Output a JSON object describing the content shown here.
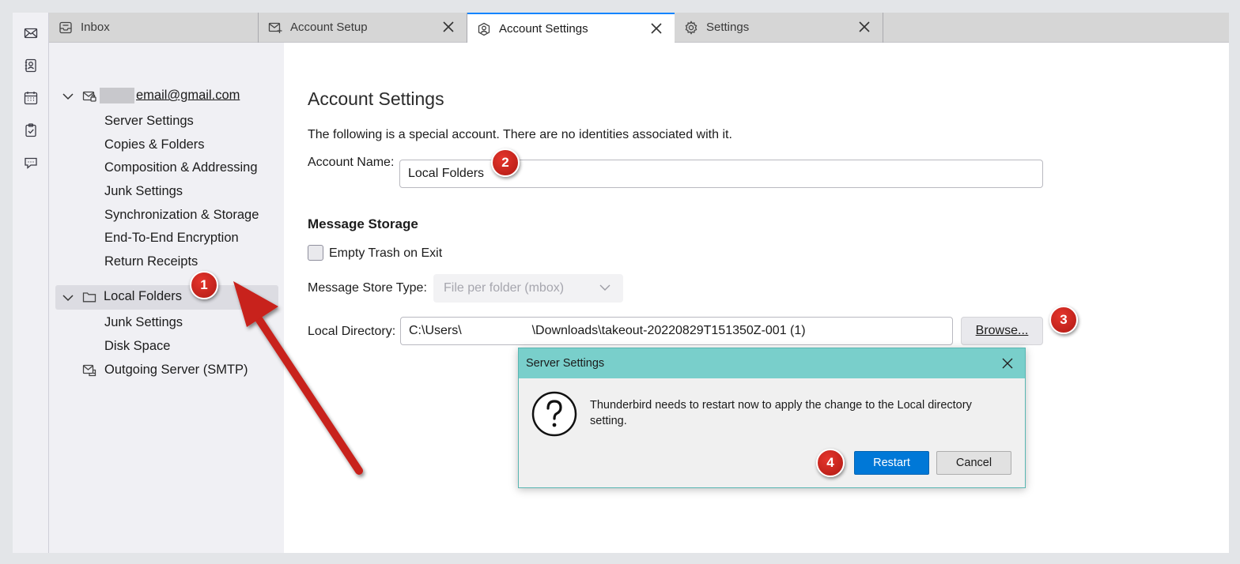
{
  "tabs": [
    {
      "label": "Inbox",
      "icon": "inbox-icon",
      "closable": false,
      "selected": false
    },
    {
      "label": "Account Setup",
      "icon": "envelope-plus-icon",
      "closable": true,
      "selected": false
    },
    {
      "label": "Account Settings",
      "icon": "account-settings-icon",
      "closable": true,
      "selected": true
    },
    {
      "label": "Settings",
      "icon": "gear-icon",
      "closable": true,
      "selected": false
    }
  ],
  "spaces": [
    "mail-icon",
    "address-book-icon",
    "calendar-icon",
    "tasks-icon",
    "chat-icon"
  ],
  "sidebar": {
    "account_email": "email@gmail.com",
    "account_items": [
      "Server Settings",
      "Copies & Folders",
      "Composition & Addressing",
      "Junk Settings",
      "Synchronization & Storage",
      "End-To-End Encryption",
      "Return Receipts"
    ],
    "local_folders_label": "Local Folders",
    "local_items": [
      "Junk Settings",
      "Disk Space"
    ],
    "outgoing_server_label": "Outgoing Server (SMTP)"
  },
  "main": {
    "title": "Account Settings",
    "special_notice": "The following is a special account. There are no identities associated with it.",
    "account_name_label": "Account Name:",
    "account_name_value": "Local Folders",
    "message_storage_heading": "Message Storage",
    "empty_trash_label": "Empty Trash on Exit",
    "empty_trash_checked": false,
    "store_type_label": "Message Store Type:",
    "store_type_value": "File per folder (mbox)",
    "local_directory_label": "Local Directory:",
    "local_directory_value": "C:\\Users\\                    \\Downloads\\takeout-20220829T151350Z-001 (1)",
    "browse_label": "Browse..."
  },
  "dialog": {
    "title": "Server Settings",
    "message": "Thunderbird needs to restart now to apply the change to the Local directory setting.",
    "restart_label": "Restart",
    "cancel_label": "Cancel"
  },
  "callouts": [
    "1",
    "2",
    "3",
    "4"
  ],
  "colors": {
    "accent": "#0a84ff",
    "dialog_titlebar": "#79cfcb",
    "primary_button": "#0078d7",
    "callout_red": "#c8201a"
  }
}
